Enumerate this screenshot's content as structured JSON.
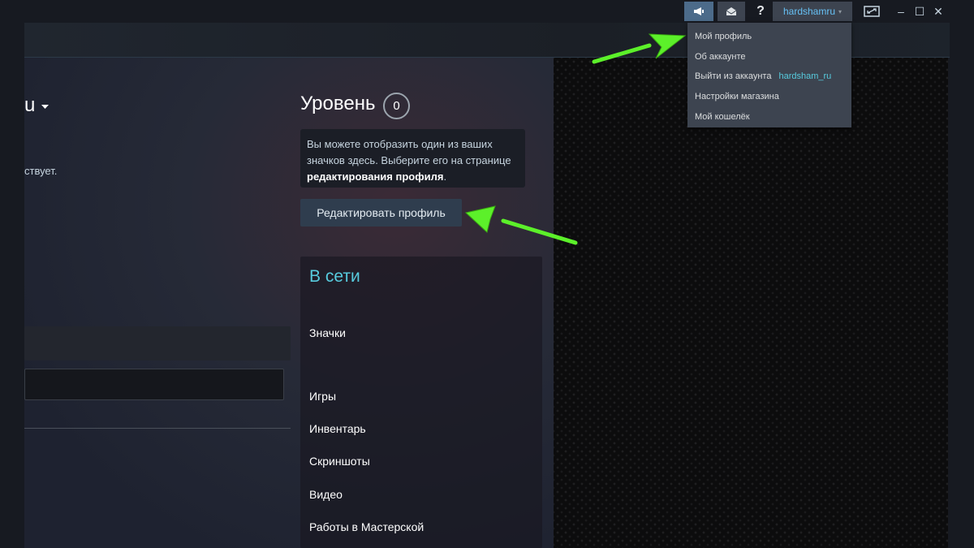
{
  "titlebar": {
    "announce_icon": "megaphone-icon",
    "mail_icon": "envelope-icon",
    "help_label": "?",
    "username": "hardshamru",
    "caret": "▾",
    "big_picture_icon": "big-picture-icon",
    "min_label": "–",
    "max_label": "☐",
    "close_label": "✕"
  },
  "dropdown": {
    "items": [
      {
        "label": "Мой профиль"
      },
      {
        "label": "Об аккаунте"
      },
      {
        "label": "Выйти из аккаунта",
        "account": "hardsham_ru"
      },
      {
        "label": "Настройки магазина"
      },
      {
        "label": "Мой кошелёк"
      }
    ]
  },
  "profile": {
    "persona_fragment": "u",
    "summary_fragment": "ствует.",
    "level_label": "Уровень",
    "level_value": "0",
    "badge_text_1": "Вы можете отобразить один из ваших значков здесь. Выберите его на странице ",
    "badge_text_bold": "редактирования профиля",
    "badge_text_2": ".",
    "edit_button": "Редактировать профиль",
    "online_status": "В сети",
    "links": {
      "badges": "Значки",
      "games": "Игры",
      "inventory": "Инвентарь",
      "screenshots": "Скриншоты",
      "videos": "Видео",
      "workshop": "Работы в Мастерской"
    }
  },
  "colors": {
    "accent_blue": "#66c0f4",
    "online_cyan": "#57cbde",
    "annotation_green": "#5cf02a"
  }
}
